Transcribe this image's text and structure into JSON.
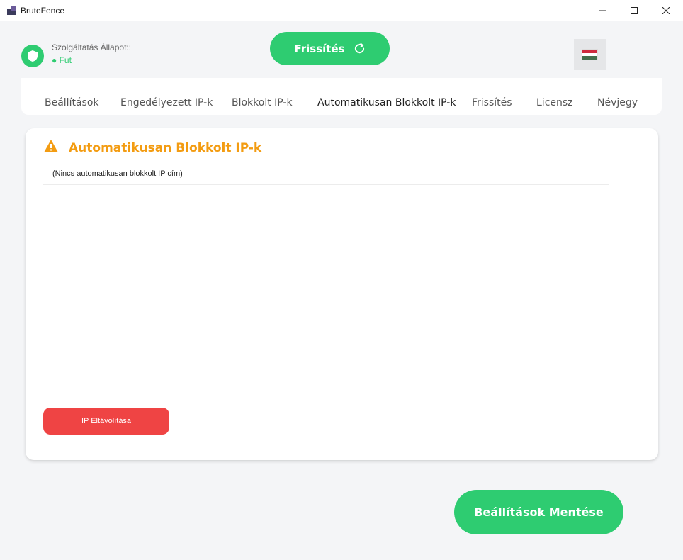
{
  "window": {
    "title": "BruteFence",
    "icon": "app-logo-icon"
  },
  "status": {
    "label": "Szolgáltatás Állapot::",
    "value": "● Fut",
    "icon": "shield-icon",
    "color": "#2ecc71"
  },
  "toolbar": {
    "refresh_label": "Frissítés",
    "refresh_icon": "refresh-icon",
    "language_icon": "hungarian-flag-icon"
  },
  "tabs": [
    {
      "label": "Beállítások"
    },
    {
      "label": "Engedélyezett IP-k"
    },
    {
      "label": "Blokkolt IP-k"
    },
    {
      "label": "Automatikusan Blokkolt IP-k",
      "active": true
    },
    {
      "label": "Frissítés"
    },
    {
      "label": "Licensz"
    },
    {
      "label": "Névjegy"
    }
  ],
  "panel": {
    "title": "Automatikusan Blokkolt IP-k",
    "title_icon": "warning-icon",
    "title_color": "#f39c12",
    "list_items": [
      "(Nincs automatikusan blokkolt IP cím)"
    ],
    "remove_button_label": "IP Eltávolítása",
    "remove_button_color": "#ef4444"
  },
  "footer": {
    "save_label": "Beállítások Mentése"
  },
  "colors": {
    "accent": "#2ecc71",
    "danger": "#ef4444",
    "warning": "#f39c12",
    "background": "#f4f5f7"
  }
}
